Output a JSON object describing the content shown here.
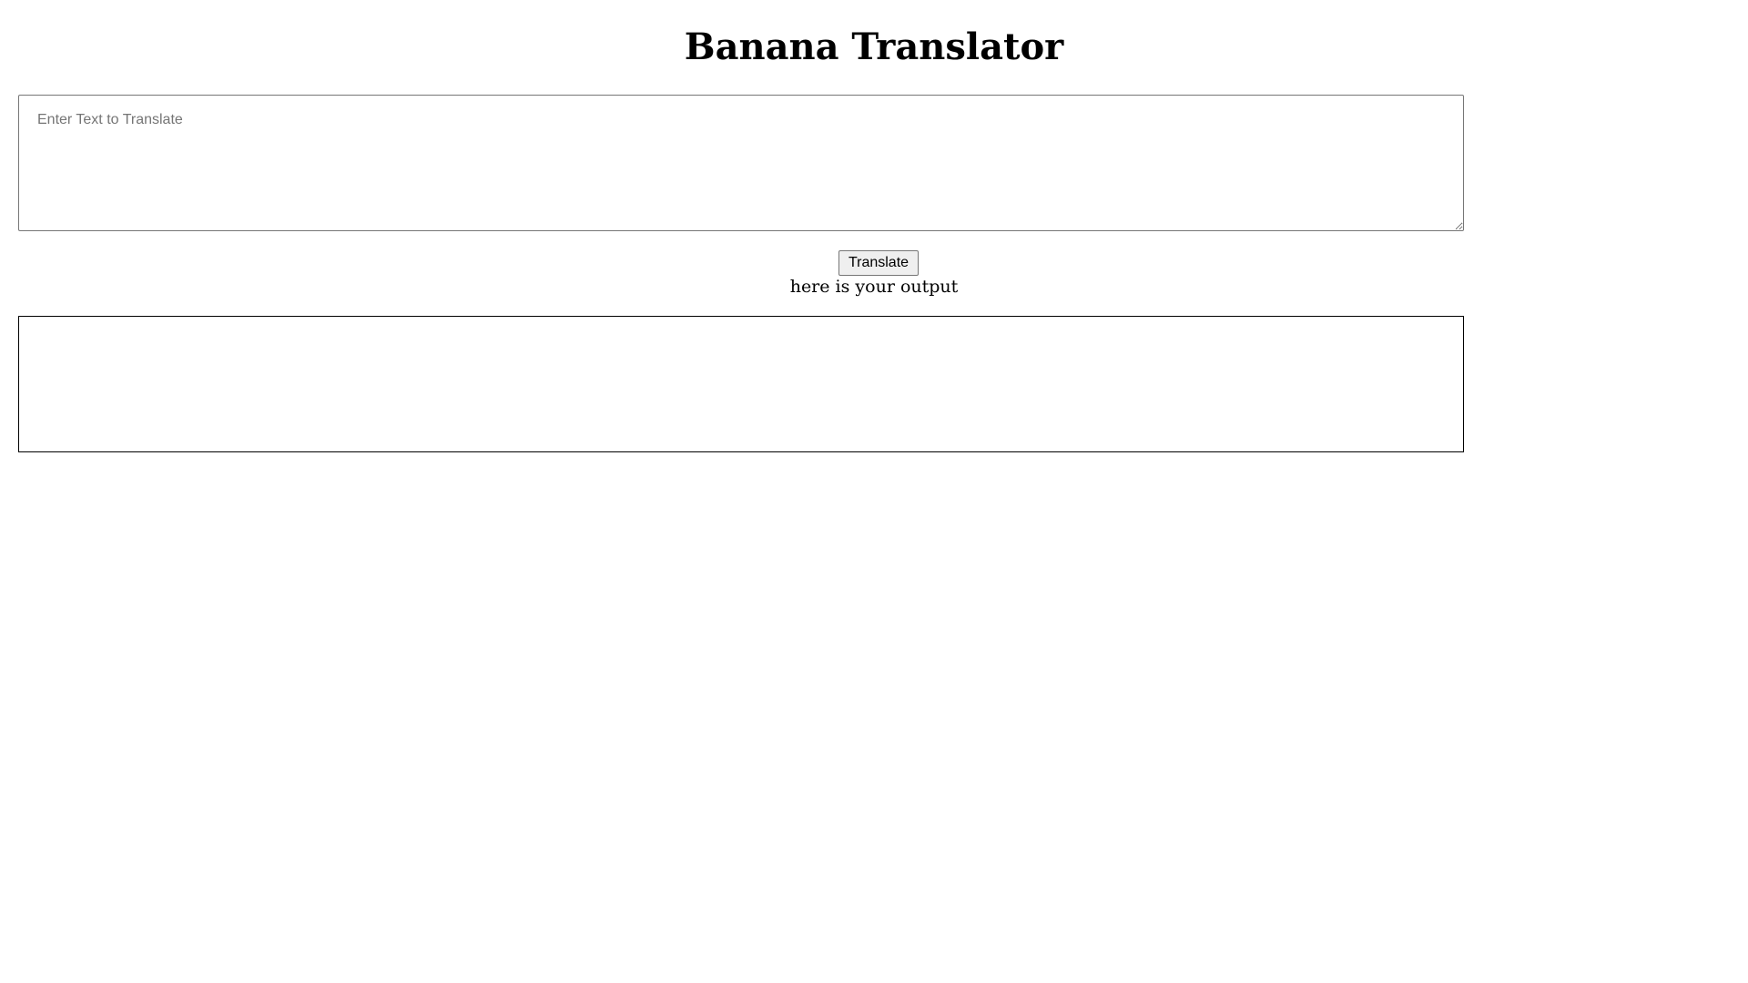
{
  "page": {
    "title": "Banana Translator"
  },
  "input": {
    "placeholder": "Enter Text to Translate",
    "value": ""
  },
  "translate_button": {
    "label": "Translate"
  },
  "output": {
    "label": "here is your output",
    "text": ""
  }
}
